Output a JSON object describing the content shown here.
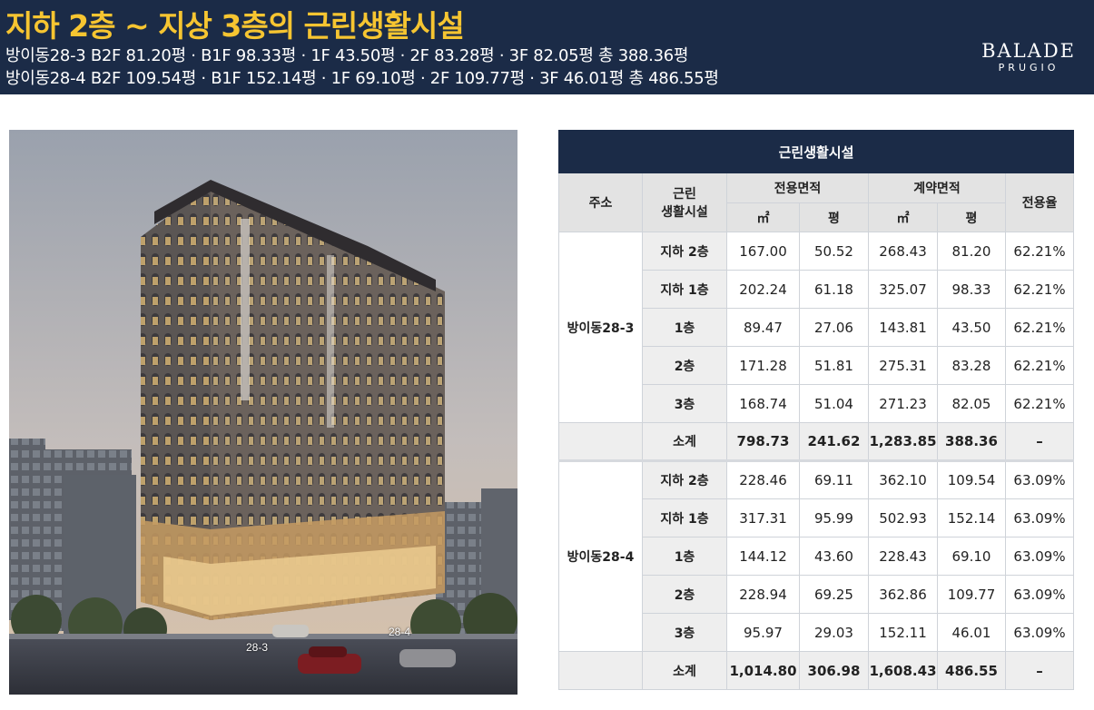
{
  "header": {
    "title": "지하 2층 ~ 지상 3층의 근린생활시설",
    "line1": "방이동28-3   B2F 81.20평 · B1F 98.33평 · 1F 43.50평 · 2F 83.28평 · 3F 82.05평   총 388.36평",
    "line2": "방이동28-4   B2F 109.54평 · B1F 152.14평 · 1F 69.10평 · 2F 109.77평 · 3F 46.01평   총 486.55평"
  },
  "logo": {
    "line1": "BALADE",
    "line2": "PRUGIO"
  },
  "render_labels": {
    "a": "28-3",
    "b": "28-4"
  },
  "table": {
    "caption": "근린생활시설",
    "headers": {
      "address": "주소",
      "facility_line1": "근린",
      "facility_line2": "생활시설",
      "exclusive": "전용면적",
      "contract": "계약면적",
      "ratio": "전용율",
      "unit_m2": "㎡",
      "unit_py": "평"
    },
    "groups": [
      {
        "address": "방이동28-3",
        "rows": [
          {
            "floor": "지하 2층",
            "ex_m2": "167.00",
            "ex_py": "50.52",
            "ct_m2": "268.43",
            "ct_py": "81.20",
            "ratio": "62.21%"
          },
          {
            "floor": "지하 1층",
            "ex_m2": "202.24",
            "ex_py": "61.18",
            "ct_m2": "325.07",
            "ct_py": "98.33",
            "ratio": "62.21%"
          },
          {
            "floor": "1층",
            "ex_m2": "89.47",
            "ex_py": "27.06",
            "ct_m2": "143.81",
            "ct_py": "43.50",
            "ratio": "62.21%"
          },
          {
            "floor": "2층",
            "ex_m2": "171.28",
            "ex_py": "51.81",
            "ct_m2": "275.31",
            "ct_py": "83.28",
            "ratio": "62.21%"
          },
          {
            "floor": "3층",
            "ex_m2": "168.74",
            "ex_py": "51.04",
            "ct_m2": "271.23",
            "ct_py": "82.05",
            "ratio": "62.21%"
          },
          {
            "floor": "소계",
            "ex_m2": "798.73",
            "ex_py": "241.62",
            "ct_m2": "1,283.85",
            "ct_py": "388.36",
            "ratio": "–"
          }
        ]
      },
      {
        "address": "방이동28-4",
        "rows": [
          {
            "floor": "지하 2층",
            "ex_m2": "228.46",
            "ex_py": "69.11",
            "ct_m2": "362.10",
            "ct_py": "109.54",
            "ratio": "63.09%"
          },
          {
            "floor": "지하 1층",
            "ex_m2": "317.31",
            "ex_py": "95.99",
            "ct_m2": "502.93",
            "ct_py": "152.14",
            "ratio": "63.09%"
          },
          {
            "floor": "1층",
            "ex_m2": "144.12",
            "ex_py": "43.60",
            "ct_m2": "228.43",
            "ct_py": "69.10",
            "ratio": "63.09%"
          },
          {
            "floor": "2층",
            "ex_m2": "228.94",
            "ex_py": "69.25",
            "ct_m2": "362.86",
            "ct_py": "109.77",
            "ratio": "63.09%"
          },
          {
            "floor": "3층",
            "ex_m2": "95.97",
            "ex_py": "29.03",
            "ct_m2": "152.11",
            "ct_py": "46.01",
            "ratio": "63.09%"
          },
          {
            "floor": "소계",
            "ex_m2": "1,014.80",
            "ex_py": "306.98",
            "ct_m2": "1,608.43",
            "ct_py": "486.55",
            "ratio": "–"
          }
        ]
      }
    ]
  }
}
